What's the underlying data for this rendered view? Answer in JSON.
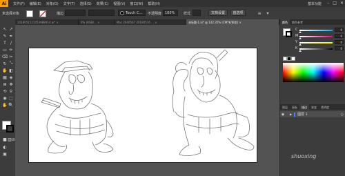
{
  "menubar": {
    "logo": "Ai",
    "items": [
      "文件(F)",
      "编辑(E)",
      "对象(O)",
      "文字(T)",
      "选择(S)",
      "效果(C)",
      "视图(V)",
      "窗口(W)",
      "帮助(H)"
    ],
    "workspace": "基本功能",
    "window_controls": [
      "–",
      "□",
      "✕"
    ]
  },
  "controlbar": {
    "no_selection": "未选择对象",
    "stroke_label": "描边",
    "brush_name": "Touch C...",
    "opacity_label": "不透明度",
    "opacity_value": "100%",
    "style_label": "样式",
    "doc_settings": "文档设置",
    "preferences": "首选项"
  },
  "tabs": [
    {
      "label": "2018051521053988914.ai* ×",
      "active": false
    },
    {
      "label": "0% (RGB/... ×",
      "active": false
    },
    {
      "label": "Mac 2040567 20180516 ... ×",
      "active": false
    },
    {
      "label": "未标题-1.ai* @ 142.35% (CMYK/预览) ×",
      "active": true
    }
  ],
  "tools": [
    "↖",
    "↗",
    "✎",
    "✒",
    "T",
    "/",
    "▭",
    "✏",
    "⌫",
    "✂",
    "↻",
    "⤡",
    "✋",
    "◧",
    "▦",
    "◈",
    "⊞",
    "✥",
    "⟲",
    "⚲",
    "◉",
    "⬚",
    "✋",
    "🔍"
  ],
  "color_panel": {
    "tabs": [
      "颜色",
      "颜色参考"
    ],
    "labels": [
      "C",
      "M",
      "Y",
      "K"
    ],
    "values": [
      "0",
      "0",
      "0",
      "0"
    ],
    "fill_color": "#ffffff",
    "stroke_color": "#000000"
  },
  "layers_panel": {
    "tabs": [
      "图层",
      "画板",
      "描边",
      "渐变",
      "透明度"
    ],
    "layer_name": "图层 1"
  },
  "watermark": "shuoxing"
}
